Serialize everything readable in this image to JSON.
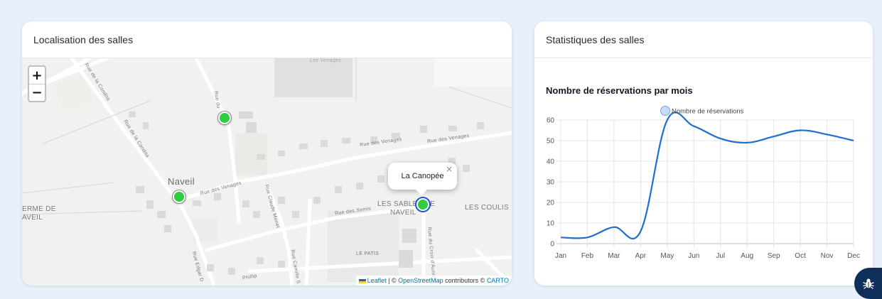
{
  "map_card": {
    "title": "Localisation des salles",
    "zoom_in": "+",
    "zoom_out": "−",
    "popup": {
      "label": "La Canopée",
      "close": "×"
    },
    "place_labels": {
      "naveil": "Naveil",
      "ferme_line1": "ERME DE",
      "ferme_line2": "AVEIL",
      "sables_line1": "LES SABLES DE",
      "sables_line2": "NAVEIL",
      "coulis": "LES COULIS",
      "patis": "LE PATIS",
      "venages_pond": "Les Venages"
    },
    "street_labels": {
      "condita1": "Rue de la Condita",
      "condita2": "Rue de la Condita",
      "venages1": "Rue des Venages",
      "venages2": "Rue des Venages",
      "venages3": "Rue des Venages",
      "claude_monet": "Rue Claude Monet",
      "semis": "Rue des Semis",
      "edgar": "Rue Edgar D",
      "camille": "Rue Camille S",
      "croix": "Rue du Croix d'Aunis",
      "ru": "Rue du",
      "rue_phillip": "Phillip"
    },
    "attribution": {
      "leaflet": "Leaflet",
      "sep": " | © ",
      "osm": "OpenStreetMap",
      "mid": " contributors © ",
      "carto": "CARTO"
    }
  },
  "stats_card": {
    "title": "Statistiques des salles",
    "chart_title": "Nombre de réservations par mois"
  },
  "chart_data": {
    "type": "line",
    "title": "Nombre de réservations par mois",
    "categories": [
      "Jan",
      "Feb",
      "Mar",
      "Apr",
      "May",
      "Jun",
      "Jul",
      "Aug",
      "Sep",
      "Oct",
      "Nov",
      "Dec"
    ],
    "series": [
      {
        "name": "Nombre de réservations",
        "values": [
          3,
          3,
          8,
          6,
          60,
          57,
          51,
          49,
          52,
          55,
          53,
          50
        ],
        "color": "#1f6fd1"
      }
    ],
    "ylim": [
      0,
      60
    ],
    "yticks": [
      0,
      10,
      20,
      30,
      40,
      50,
      60
    ],
    "grid": true,
    "legend": "top-center"
  },
  "colors": {
    "marker": "#2ecc40",
    "page_bg": "#e8f0fb",
    "fab": "#0f2f5a"
  },
  "fab": {
    "icon": "bug-icon"
  }
}
